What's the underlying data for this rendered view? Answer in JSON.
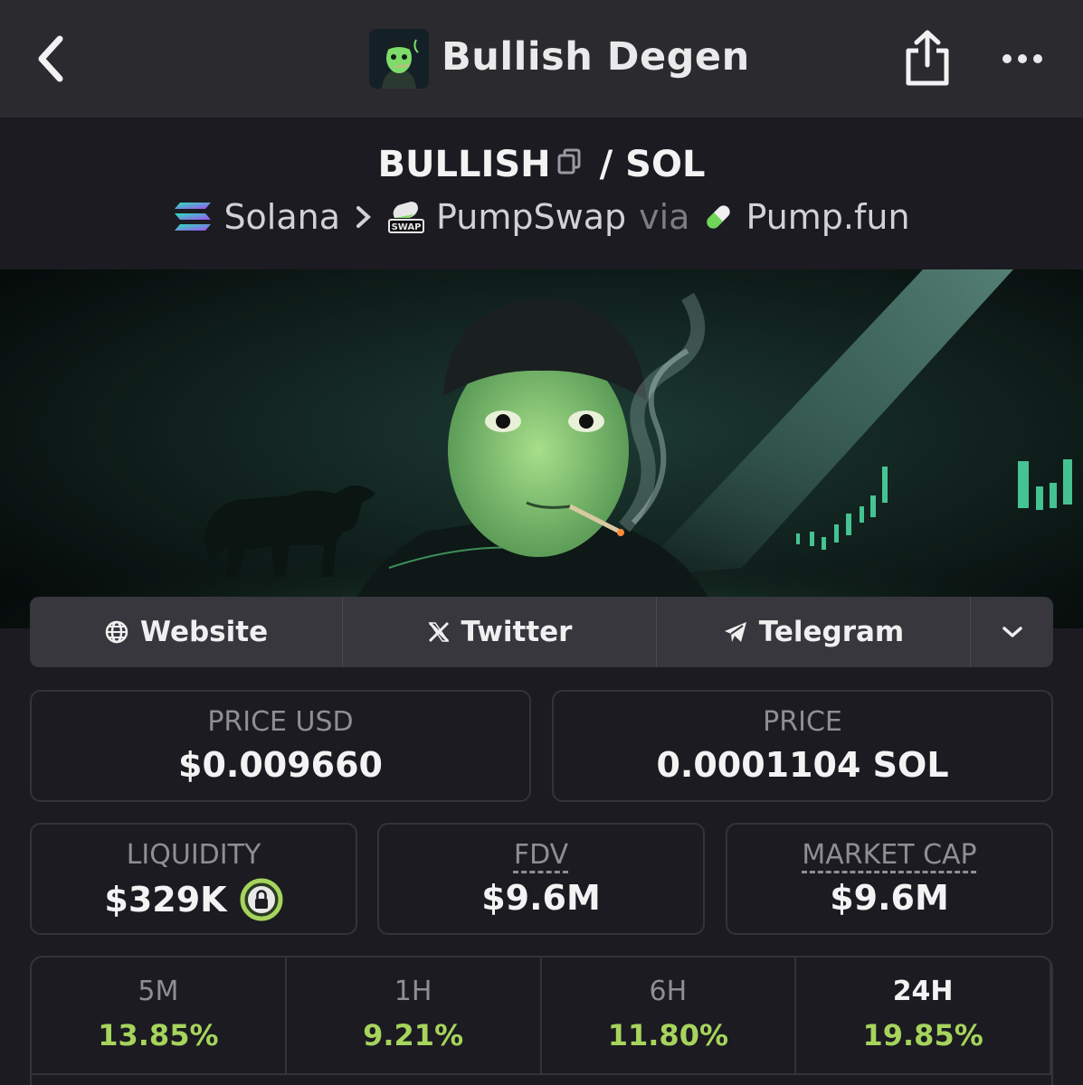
{
  "header": {
    "title": "Bullish Degen",
    "back_icon": "chevron-left-icon",
    "share_icon": "share-icon",
    "more_icon": "more-icon"
  },
  "pair": {
    "base": "BULLISH",
    "separator": "/",
    "quote": "SOL"
  },
  "route": {
    "chain": "Solana",
    "dex": "PumpSwap",
    "via": "via",
    "launchpad": "Pump.fun",
    "dex_badge": "SWAP"
  },
  "socials": [
    {
      "label": "Website",
      "icon": "globe-icon"
    },
    {
      "label": "Twitter",
      "icon": "x-icon"
    },
    {
      "label": "Telegram",
      "icon": "telegram-icon"
    }
  ],
  "stats": {
    "price_usd_label": "PRICE USD",
    "price_usd": "$0.009660",
    "price_label": "PRICE",
    "price": "0.0001104 SOL",
    "liquidity_label": "LIQUIDITY",
    "liquidity": "$329K",
    "fdv_label": "FDV",
    "fdv": "$9.6M",
    "mcap_label": "MARKET CAP",
    "mcap": "$9.6M"
  },
  "timeframes": [
    {
      "label": "5M",
      "value": "13.85%"
    },
    {
      "label": "1H",
      "value": "9.21%"
    },
    {
      "label": "6H",
      "value": "11.80%"
    },
    {
      "label": "24H",
      "value": "19.85%"
    }
  ],
  "colors": {
    "positive": "#a6d45c",
    "background": "#1b1b21",
    "topbar": "#2a2a2f"
  }
}
